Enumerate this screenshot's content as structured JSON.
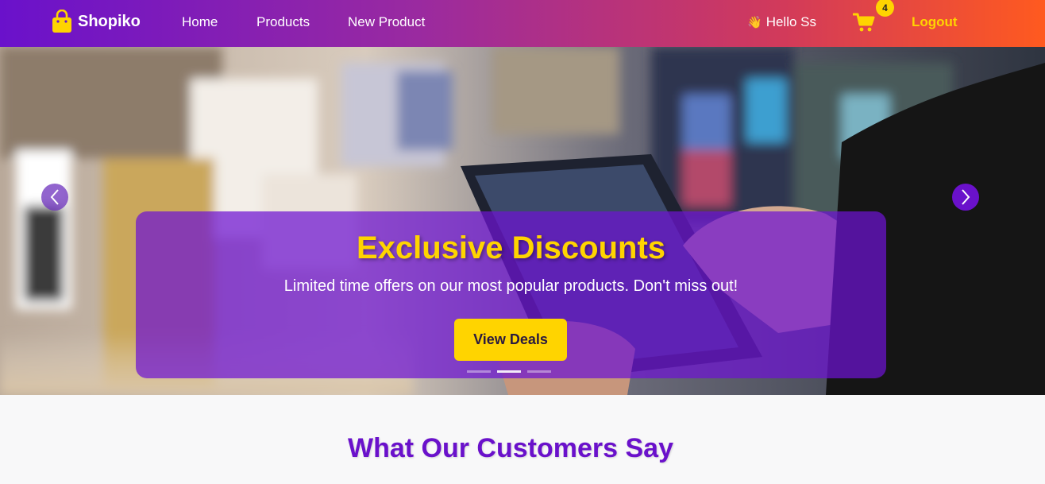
{
  "navbar": {
    "brand": "Shopiko",
    "links": [
      "Home",
      "Products",
      "New Product"
    ],
    "greeting_icon": "👋",
    "greeting": "Hello Ss",
    "cart_count": "4",
    "logout": "Logout"
  },
  "hero": {
    "title": "Exclusive Discounts",
    "subtitle": "Limited time offers on our most popular products. Don't miss out!",
    "button": "View Deals",
    "slide_count": 3,
    "active_slide": 2
  },
  "testimonials": {
    "title": "What Our Customers Say"
  },
  "colors": {
    "accent": "#6a11cb",
    "highlight": "#ffd400",
    "gradient_end": "#ff5a1f"
  },
  "icons": {
    "brand": "shopping-bag-icon",
    "cart": "shopping-cart-icon",
    "prev": "chevron-left-icon",
    "next": "chevron-right-icon"
  }
}
